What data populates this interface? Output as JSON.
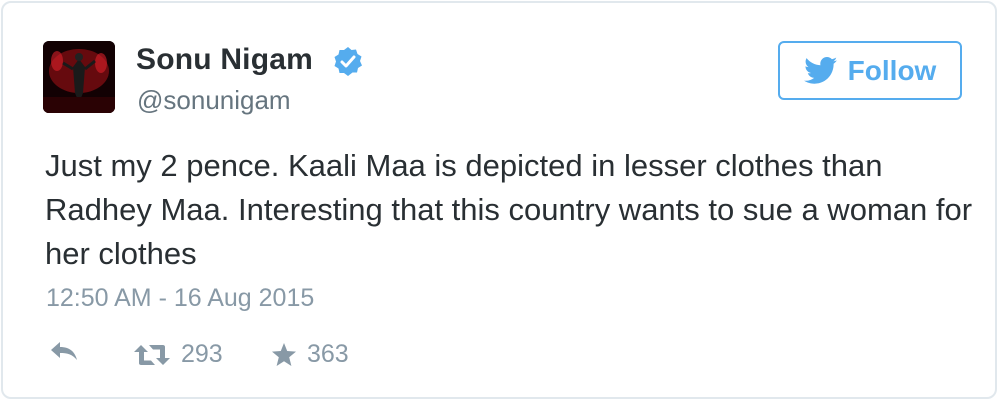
{
  "user": {
    "name": "Sonu Nigam",
    "handle": "@sonunigam",
    "verified": true
  },
  "follow_label": "Follow",
  "tweet": {
    "text": "Just my 2 pence. Kaali Maa is depicted in lesser clothes than Radhey Maa. Interesting that this country wants to sue a woman for her clothes",
    "timestamp": "12:50 AM - 16 Aug 2015"
  },
  "actions": {
    "retweet_count": "293",
    "favorite_count": "363"
  },
  "colors": {
    "accent": "#55acee",
    "text": "#292f33",
    "muted": "#8899a6",
    "border": "#e1e8ed"
  },
  "icons": [
    "avatar-image",
    "verified-badge-icon",
    "twitter-bird-icon",
    "reply-icon",
    "retweet-icon",
    "star-icon"
  ]
}
